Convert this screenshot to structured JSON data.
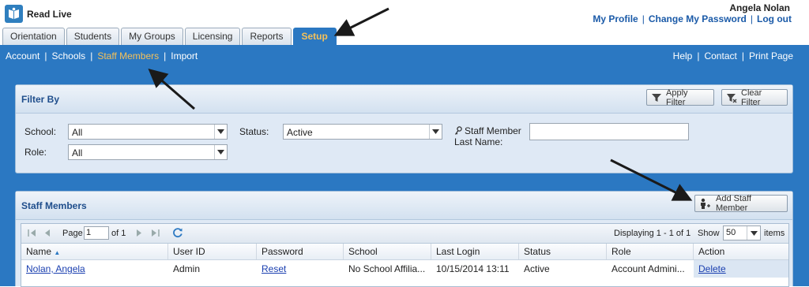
{
  "app": {
    "name": "Read Live"
  },
  "user": {
    "name": "Angela Nolan",
    "links": [
      "My Profile",
      "Change My Password",
      "Log out"
    ]
  },
  "tabs": [
    {
      "label": "Orientation",
      "active": false
    },
    {
      "label": "Students",
      "active": false
    },
    {
      "label": "My Groups",
      "active": false
    },
    {
      "label": "Licensing",
      "active": false
    },
    {
      "label": "Reports",
      "active": false
    },
    {
      "label": "Setup",
      "active": true
    }
  ],
  "subnav": {
    "items": [
      {
        "label": "Account",
        "active": false
      },
      {
        "label": "Schools",
        "active": false
      },
      {
        "label": "Staff Members",
        "active": true
      },
      {
        "label": "Import",
        "active": false
      }
    ],
    "right": [
      "Help",
      "Contact",
      "Print Page"
    ]
  },
  "filter": {
    "title": "Filter By",
    "apply_label": "Apply Filter",
    "clear_label": "Clear Filter",
    "school_label": "School:",
    "school_value": "All",
    "role_label": "Role:",
    "role_value": "All",
    "status_label": "Status:",
    "status_value": "Active",
    "lastname_label_1": "Staff Member",
    "lastname_label_2": "Last Name:",
    "lastname_value": ""
  },
  "staff": {
    "title": "Staff Members",
    "add_label": "Add Staff Member",
    "pager": {
      "page_label": "Page",
      "page_value": "1",
      "of_label": "of 1",
      "displaying": "Displaying 1 - 1 of 1",
      "show_label": "Show",
      "show_value": "50",
      "items_label": "items"
    },
    "columns": [
      "Name",
      "User ID",
      "Password",
      "School",
      "Last Login",
      "Status",
      "Role",
      "Action"
    ],
    "rows": [
      {
        "name": "Nolan, Angela",
        "user_id": "Admin",
        "password": "Reset",
        "school": "No School Affilia...",
        "last_login": "10/15/2014 13:11",
        "status": "Active",
        "role": "Account Admini...",
        "action": "Delete"
      }
    ]
  },
  "colors": {
    "brand_blue": "#2b78c2",
    "active_orange": "#f5c15a",
    "link_blue": "#1a5aa8"
  }
}
